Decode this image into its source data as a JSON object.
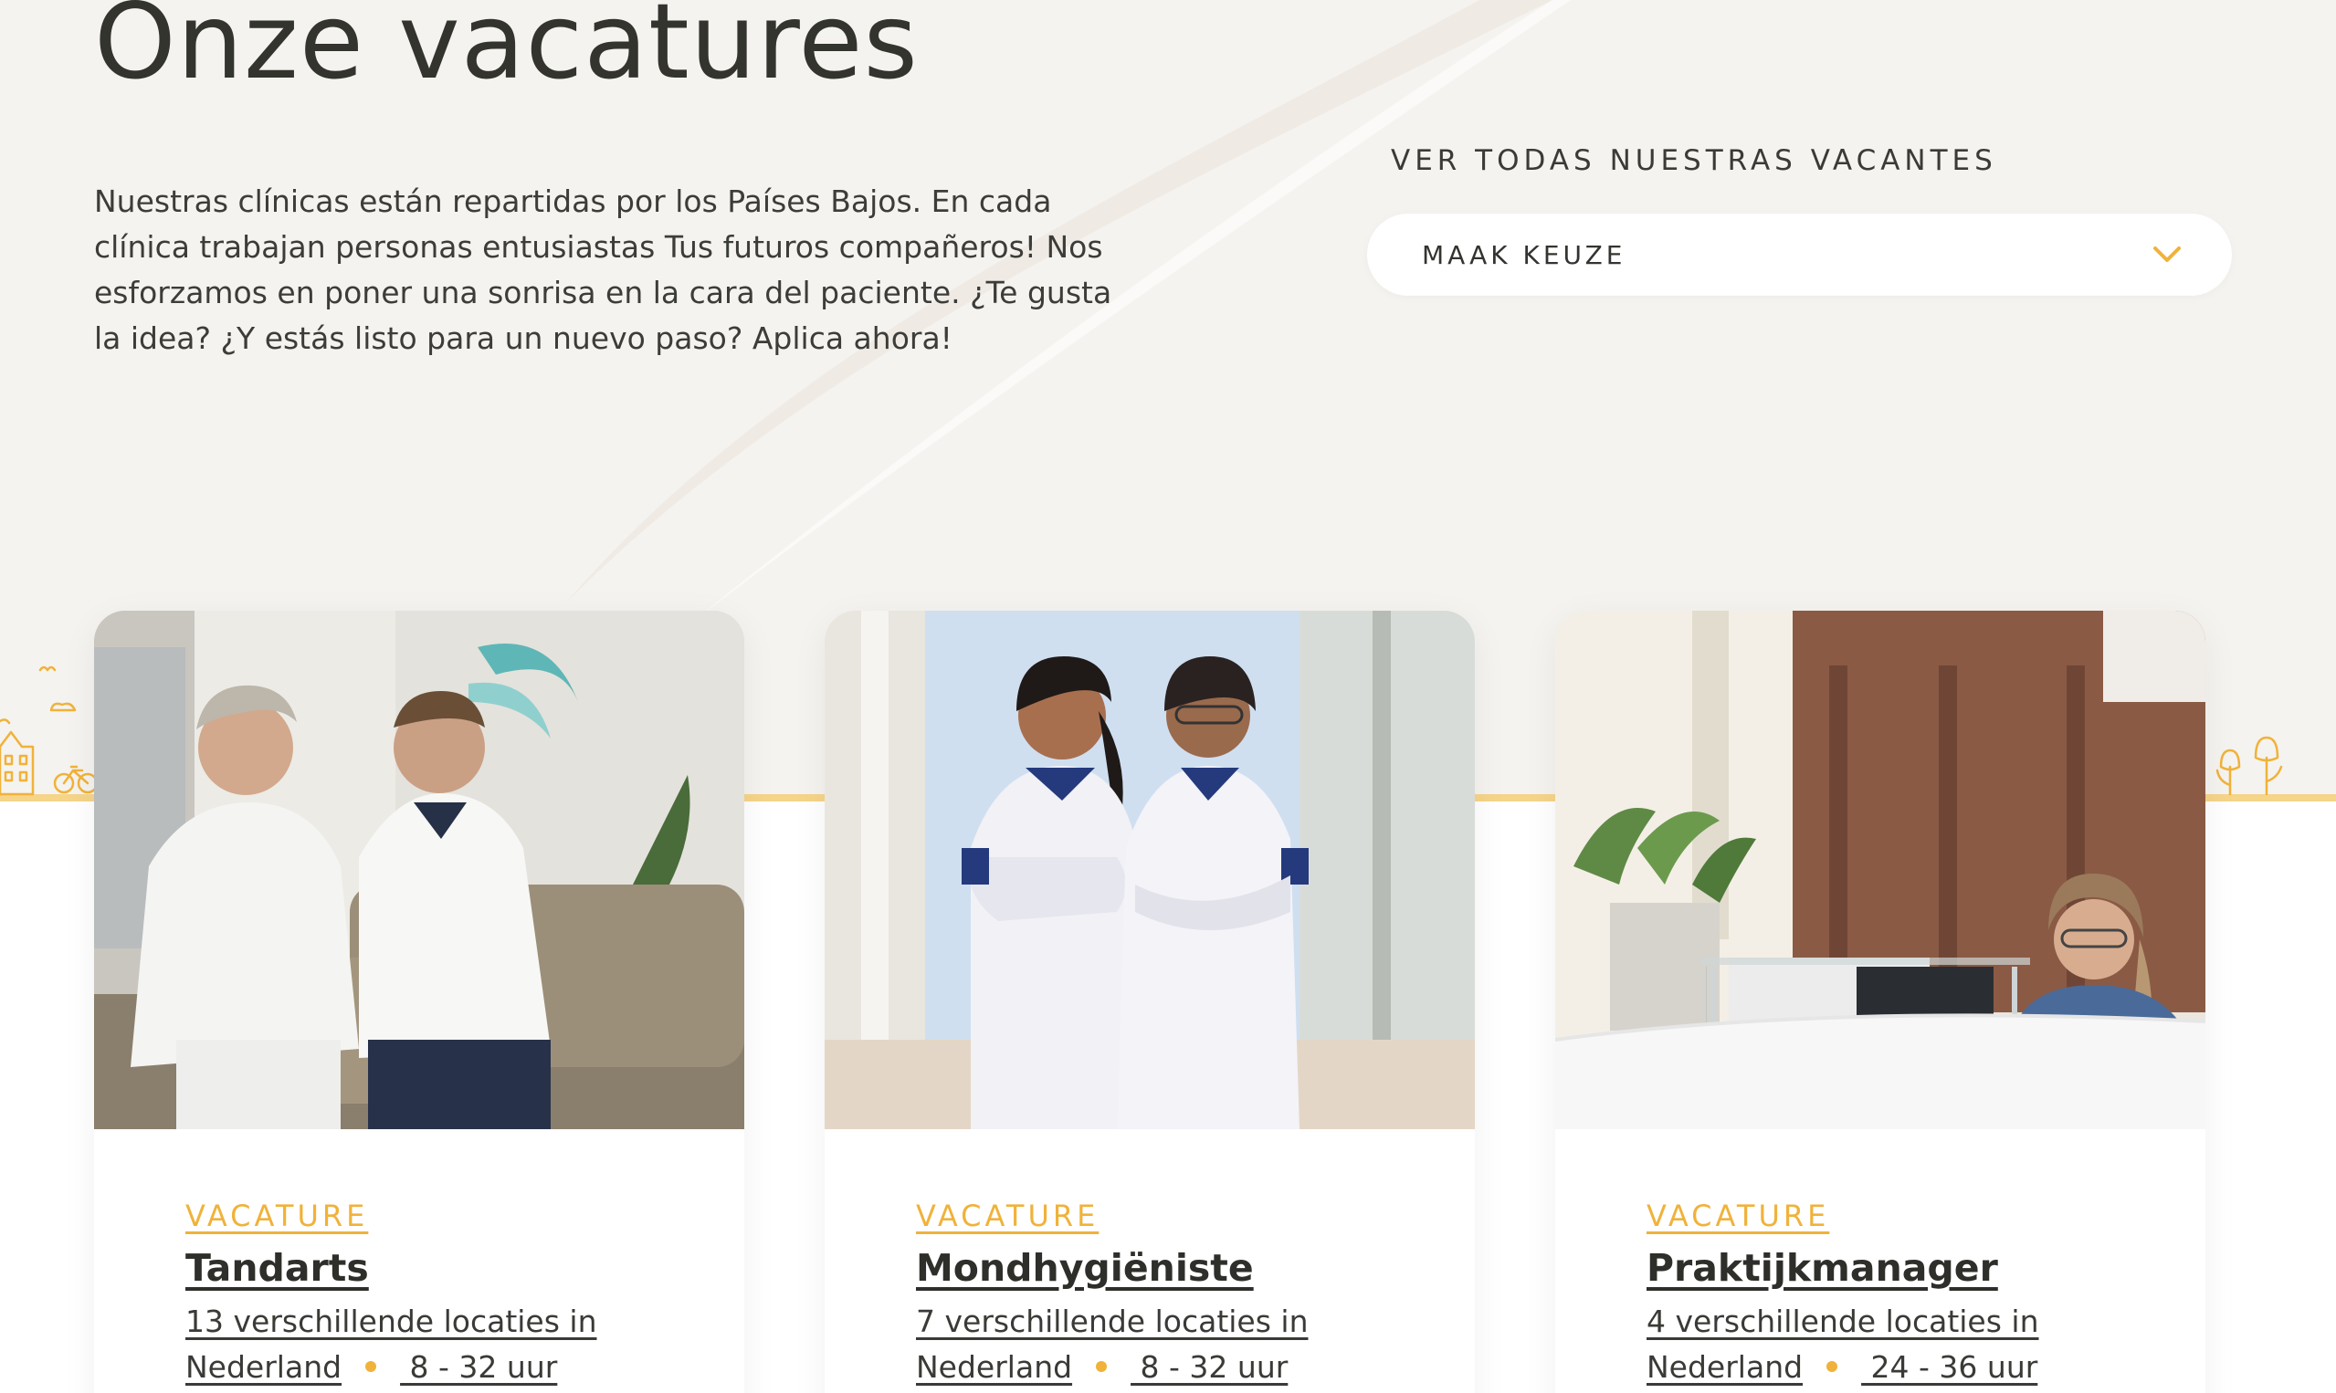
{
  "page": {
    "title": "Onze vacatures",
    "intro": "Nuestras clínicas están repartidas por los Países Bajos. En cada clínica trabajan personas entusiastas Tus futuros compañeros! Nos esforzamos en poner una sonrisa en la cara del paciente. ¿Te gusta la idea? ¿Y estás listo para un nuevo paso? Aplica ahora!"
  },
  "filter": {
    "label": "VER TODAS NUESTRAS VACANTES",
    "selected": "MAAK KEUZE",
    "icon": "chevron-down-icon"
  },
  "colors": {
    "accent": "#f0b23a",
    "background": "#f5f3ef",
    "text": "#3a3a36",
    "deco_line": "#f6d589"
  },
  "vacancies": [
    {
      "kicker": "VACATURE",
      "title": "Tandarts",
      "locations_line1": "13 verschillende locaties in",
      "locations_line2": "Nederland",
      "hours": " 8 - 32 uur",
      "image": "photo-two-dentists"
    },
    {
      "kicker": "VACATURE",
      "title": "Mondhygiëniste",
      "locations_line1": "7 verschillende locaties in",
      "locations_line2": "Nederland",
      "hours": " 8 - 32 uur",
      "image": "photo-two-hygienists"
    },
    {
      "kicker": "VACATURE",
      "title": "Praktijkmanager",
      "locations_line1": "4 verschillende locaties in",
      "locations_line2": "Nederland",
      "hours": " 24 - 36 uur",
      "image": "photo-reception-desk"
    }
  ]
}
